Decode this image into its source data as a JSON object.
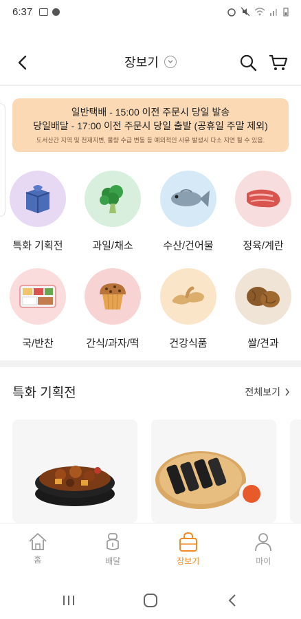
{
  "status_bar": {
    "time": "6:37"
  },
  "header": {
    "title": "장보기"
  },
  "notice": {
    "line1": "일반택배 - 15:00 이전 주문시 당일 발송",
    "line2": "당일배달 - 17:00 이전 주문시 당일 출발 (공휴일 주말 제외)",
    "line3": "도서산간 지역 및 천재지변, 물량 수급 변동 등 예외적인 사유 발생시 다소 지연 될 수 있음."
  },
  "categories": [
    {
      "label": "특화 기획전",
      "icon": "package-icon",
      "bg": "#e7d9f3"
    },
    {
      "label": "과일/채소",
      "icon": "broccoli-icon",
      "bg": "#d7efdc"
    },
    {
      "label": "수산/건어물",
      "icon": "fish-icon",
      "bg": "#d6e9f7"
    },
    {
      "label": "정육/계란",
      "icon": "meat-icon",
      "bg": "#f7dddd"
    },
    {
      "label": "국/반찬",
      "icon": "lunchbox-icon",
      "bg": "#fadcdc"
    },
    {
      "label": "간식/과자/떡",
      "icon": "muffin-icon",
      "bg": "#f8d3d3"
    },
    {
      "label": "건강식품",
      "icon": "ginger-icon",
      "bg": "#fbe5c8"
    },
    {
      "label": "쌀/견과",
      "icon": "walnut-icon",
      "bg": "#efe4d6"
    }
  ],
  "section": {
    "title": "특화 기획전",
    "more": "전체보기"
  },
  "bottom_nav": [
    {
      "label": "홈",
      "icon": "home-icon",
      "active": false
    },
    {
      "label": "배달",
      "icon": "delivery-icon",
      "active": false
    },
    {
      "label": "장보기",
      "icon": "shopping-bag-icon",
      "active": true
    },
    {
      "label": "마이",
      "icon": "person-icon",
      "active": false
    }
  ],
  "colors": {
    "accent": "#f08a24",
    "notice_bg": "#fbd9b5"
  }
}
